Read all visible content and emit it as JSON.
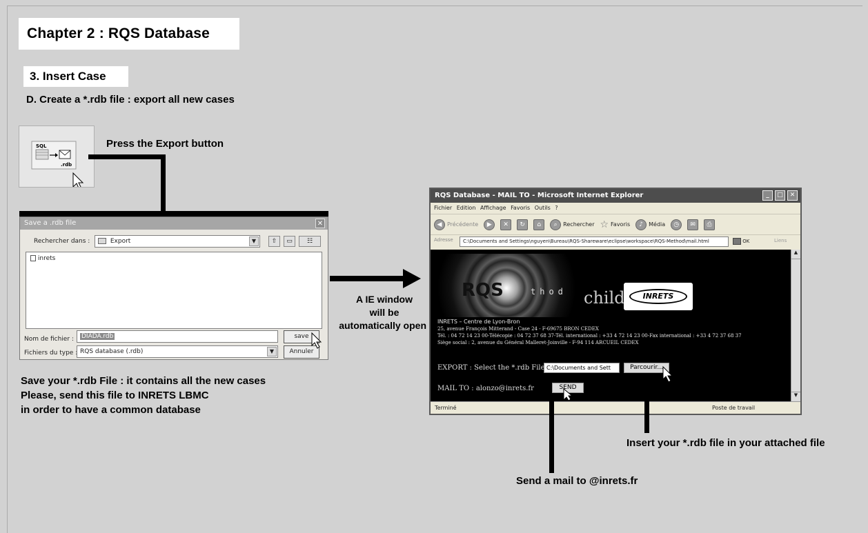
{
  "slide": {
    "title": "Chapter 2 : RQS Database",
    "section": "3. Insert Case",
    "step": "D. Create a *.rdb file : export all new cases"
  },
  "export_icon": {
    "sql_label": "SQL",
    "rdb_label": ".rdb"
  },
  "annotations": {
    "press_export": "Press the Export button",
    "ie_open_line1": "A IE window",
    "ie_open_line2": "will be",
    "ie_open_line3": "automatically open",
    "save_line1": "Save your *.rdb File : it contains all the new cases",
    "save_line2": "Please, send this file to INRETS LBMC",
    "save_line3": "in order to have a common database",
    "insert_file": "Insert your *.rdb file in your attached file",
    "send_mail": "Send a mail to @inrets.fr"
  },
  "save_dialog": {
    "title": "Save a .rdb file",
    "lookin_label": "Rechercher dans :",
    "lookin_value": "Export",
    "list_item": "inrets",
    "filename_label": "Nom de fichier :",
    "filename_value": "DIADA.rdb",
    "filetype_label": "Fichiers du type :",
    "filetype_value": "RQS database (.rdb)",
    "save_button": "save",
    "cancel_button": "Annuler"
  },
  "ie_window": {
    "title": "RQS Database - MAIL TO - Microsoft Internet Explorer",
    "menu": [
      "Fichier",
      "Edition",
      "Affichage",
      "Favoris",
      "Outils",
      "?"
    ],
    "toolbar": {
      "back": "Précédente",
      "search": "Rechercher",
      "favorites": "Favoris",
      "media": "Média"
    },
    "address_label": "Adresse",
    "address_value": "C:\\Documents and Settings\\nguyen\\Bureau\\RQS-Shareware\\eclipse\\workspace\\RQS-Method\\mail.html",
    "go_label": "OK",
    "links_label": "Liens",
    "content": {
      "logo_rqs": "RQS",
      "logo_method": "thod",
      "logo_child": "child",
      "logo_inrets": "INRETS",
      "addr1": "INRETS – Centre de Lyon-Bron",
      "addr2": "25, avenue François Mitterand - Case 24 - F-69675 BRON CEDEX",
      "addr3": "Tél. : 04 72 14 23 00-Télécopie : 04 72 37 68 37-Tél. international : +33 4 72 14 23 00-Fax international : +33 4 72 37 68 37",
      "addr4": "Siège social : 2, avenue du Général Malleret-Joinville - F-94 114 ARCUEIL CEDEX",
      "export_label": "EXPORT : Select the *.rdb File",
      "export_value": "C:\\Documents and Sett",
      "browse_button": "Parcourir...",
      "mailto_label": "MAIL TO : alonzo@inrets.fr",
      "send_button": "SEND"
    },
    "status_left": "Terminé",
    "status_right": "Poste de travail"
  }
}
